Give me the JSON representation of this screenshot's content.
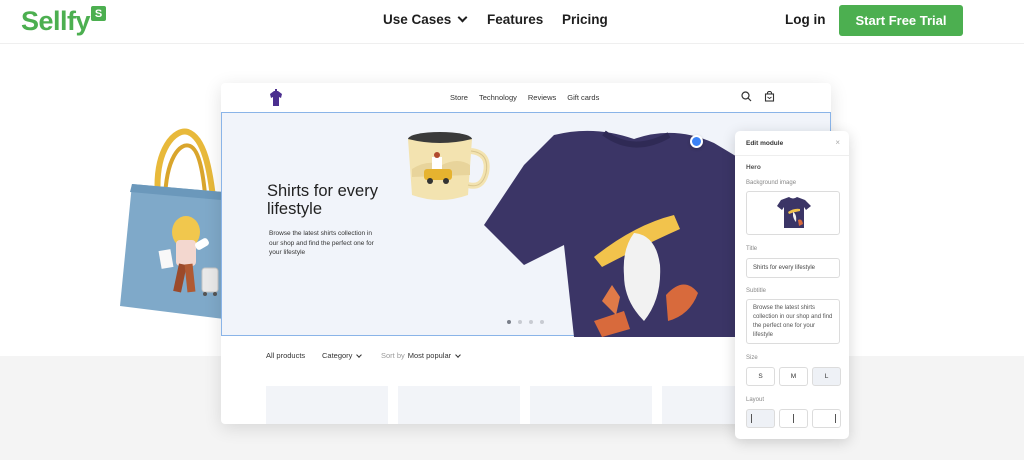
{
  "brand": {
    "name": "Sellfy",
    "badge": "S",
    "accent": "#4caf50"
  },
  "nav": {
    "links": [
      {
        "label": "Use Cases",
        "has_dropdown": true
      },
      {
        "label": "Features"
      },
      {
        "label": "Pricing"
      }
    ],
    "login": "Log in",
    "cta": "Start Free Trial"
  },
  "store": {
    "menu": [
      "Store",
      "Technology",
      "Reviews",
      "Gift cards"
    ],
    "hero": {
      "title": "Shirts for every lifestyle",
      "subtitle": "Browse the latest shirts collection in our shop and find the perfect one for your lifestyle",
      "slides": 4,
      "active_slide": 1
    },
    "filters": {
      "all": "All products",
      "category": "Category",
      "sort_label": "Sort by",
      "sort_value": "Most popular"
    }
  },
  "panel": {
    "title": "Edit module",
    "close": "×",
    "section": "Hero",
    "background_label": "Background image",
    "title_label": "Title",
    "title_value": "Shirts for every lifestyle",
    "subtitle_label": "Subtitle",
    "subtitle_value": "Browse the latest shirts collection in our shop and find the perfect one for your lifestyle",
    "size_label": "Size",
    "sizes": [
      "S",
      "M",
      "L"
    ],
    "selected_size": "L",
    "layout_label": "Layout"
  }
}
